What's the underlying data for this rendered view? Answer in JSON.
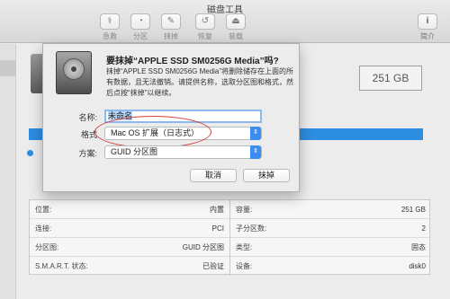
{
  "window": {
    "title": "磁盘工具"
  },
  "toolbar": {
    "items": [
      {
        "label": "急救",
        "icon": "stethoscope-icon",
        "glyph": "⚕"
      },
      {
        "label": "分区",
        "icon": "partition-icon",
        "glyph": "◔"
      },
      {
        "label": "抹掉",
        "icon": "erase-icon",
        "glyph": "✎"
      },
      {
        "label": "恢复",
        "icon": "restore-icon",
        "glyph": "↺"
      },
      {
        "label": "装载",
        "icon": "mount-icon",
        "glyph": "⏏"
      }
    ],
    "info": {
      "label": "简介",
      "glyph": "i"
    }
  },
  "main": {
    "capacity": "251 GB",
    "info_left": [
      {
        "key": "位置:",
        "value": "内置"
      },
      {
        "key": "连接:",
        "value": "PCI"
      },
      {
        "key": "分区图:",
        "value": "GUID 分区图"
      },
      {
        "key": "S.M.A.R.T. 状态:",
        "value": "已验证"
      }
    ],
    "info_right": [
      {
        "key": "容量:",
        "value": "251 GB"
      },
      {
        "key": "子分区数:",
        "value": "2"
      },
      {
        "key": "类型:",
        "value": "固态"
      },
      {
        "key": "设备:",
        "value": "disk0"
      }
    ]
  },
  "dialog": {
    "title": "要抹掉“APPLE SSD SM0256G Media”吗?",
    "description": "抹掉“APPLE SSD SM0256G Media”将删除储存在上面的所有数据，且无法撤销。请提供名称，选取分区图和格式，然后点按“抹掉”以继续。",
    "name_label": "名称:",
    "name_value": "未命名",
    "format_label": "格式",
    "format_value": "Mac OS 扩展（日志式）",
    "scheme_label": "方案:",
    "scheme_value": "GUID 分区图",
    "cancel_label": "取消",
    "erase_label": "抹掉"
  },
  "colors": {
    "accent": "#3b8ef0",
    "annotation": "#d43c3c"
  }
}
